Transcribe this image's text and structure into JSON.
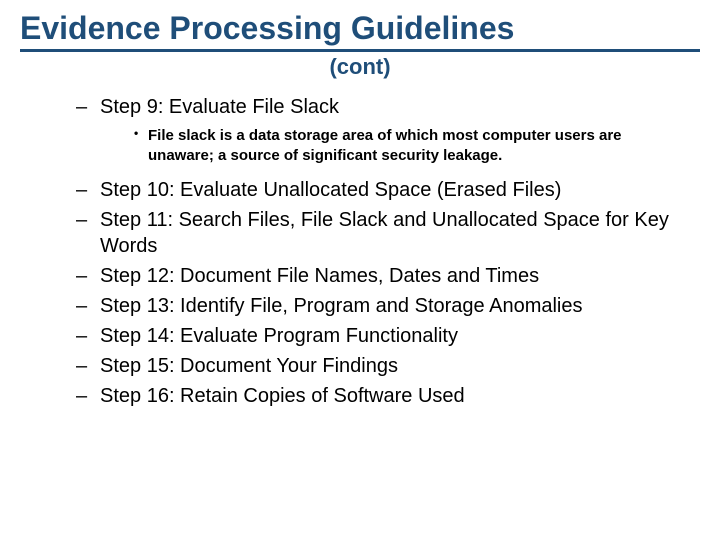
{
  "title": "Evidence Processing Guidelines",
  "subtitle": "(cont)",
  "steps": {
    "s9": "Step 9: Evaluate File Slack",
    "s9_note": "File slack is a data storage area of which most computer users are unaware; a source of significant security leakage.",
    "s10": "Step 10: Evaluate Unallocated Space (Erased Files)",
    "s11": "Step 11: Search Files, File Slack and Unallocated Space for Key Words",
    "s12": "Step 12: Document File Names, Dates and Times",
    "s13": "Step 13: Identify File, Program and Storage Anomalies",
    "s14": "Step 14: Evaluate Program Functionality",
    "s15": "Step 15: Document Your Findings",
    "s16": "Step 16: Retain Copies of Software Used"
  }
}
